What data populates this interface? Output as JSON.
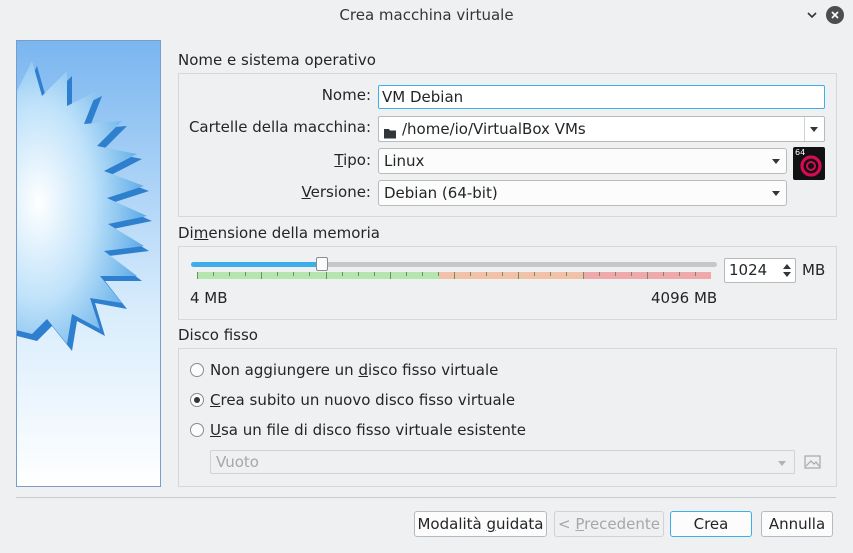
{
  "window": {
    "title": "Crea macchina virtuale"
  },
  "name_os": {
    "section_title": "Nome e sistema operativo",
    "name_label": "Nome:",
    "name_value": "VM Debian",
    "folder_label": "Cartelle della macchina:",
    "folder_value": "/home/io/VirtualBox VMs",
    "type_label_pre": "",
    "type_label_u": "T",
    "type_label_post": "ipo:",
    "type_value": "Linux",
    "version_label_u": "V",
    "version_label_post": "ersione:",
    "version_value": "Debian (64-bit)",
    "os_badge": "64"
  },
  "memory": {
    "section_title_pre": "Di",
    "section_title_u": "m",
    "section_title_post": "ensione della memoria",
    "value": "1024",
    "unit": "MB",
    "min_label": "4 MB",
    "max_label": "4096 MB",
    "value_fraction": 0.249
  },
  "disk": {
    "section_title": "Disco fisso",
    "options": [
      {
        "pre": "Non aggiungere un ",
        "u": "d",
        "post": "isco fisso virtuale",
        "checked": false
      },
      {
        "pre": "",
        "u": "C",
        "post": "rea subito un nuovo disco fisso virtuale",
        "checked": true
      },
      {
        "pre": "",
        "u": "U",
        "post": "sa un file di disco fisso virtuale esistente",
        "checked": false
      }
    ],
    "existing_placeholder": "Vuoto"
  },
  "buttons": {
    "guided_pre": "Modalità ",
    "guided_u": "g",
    "guided_post": "uidata",
    "back_pre": "< ",
    "back_u": "P",
    "back_post": "recedente",
    "create": "Crea",
    "cancel": "Annulla"
  },
  "colors": {
    "accent": "#3daee9",
    "scale_green": "#b6e6b0",
    "scale_orange": "#f2c2a8",
    "scale_red": "#f0a9a9"
  }
}
